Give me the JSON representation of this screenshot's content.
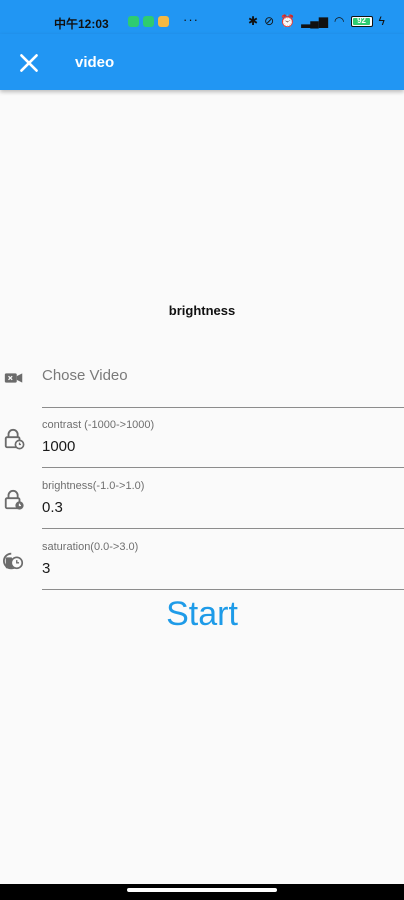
{
  "status_bar": {
    "time": "中午12:03",
    "dots": "···",
    "battery_level": "92",
    "notification_colors": [
      "#2ecc71",
      "#2ecc71",
      "#f5b942"
    ]
  },
  "app_bar": {
    "title": "video",
    "close_icon": "close-icon"
  },
  "preview": {
    "label": "brightness"
  },
  "form": {
    "video": {
      "placeholder": "Chose Video",
      "icon": "video-camera-icon"
    },
    "contrast": {
      "label": "contrast (-1000->1000)",
      "value": "1000",
      "icon": "lock-clock-icon"
    },
    "brightness": {
      "label": "brightness(-1.0->1.0)",
      "value": "0.3",
      "icon": "lock-clock-icon"
    },
    "saturation": {
      "label": "saturation(0.0->3.0)",
      "value": "3",
      "icon": "history-icon"
    }
  },
  "actions": {
    "start_label": "Start"
  },
  "colors": {
    "primary": "#2196f3",
    "start_text": "#1e9be8"
  }
}
